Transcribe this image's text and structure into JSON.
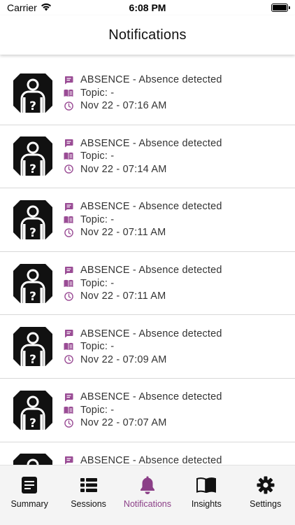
{
  "status": {
    "carrier": "Carrier",
    "time": "6:08 PM"
  },
  "header": {
    "title": "Notifications"
  },
  "colors": {
    "accent": "#8b3f87",
    "icon_purple": "#9a4c95"
  },
  "notifications": [
    {
      "type": "ABSENCE - Absence detected",
      "topic": "Topic: -",
      "time": "Nov 22 - 07:16 AM"
    },
    {
      "type": "ABSENCE - Absence detected",
      "topic": "Topic: -",
      "time": "Nov 22 - 07:14 AM"
    },
    {
      "type": "ABSENCE - Absence detected",
      "topic": "Topic: -",
      "time": "Nov 22 - 07:11 AM"
    },
    {
      "type": "ABSENCE - Absence detected",
      "topic": "Topic: -",
      "time": "Nov 22 - 07:11 AM"
    },
    {
      "type": "ABSENCE - Absence detected",
      "topic": "Topic: -",
      "time": "Nov 22 - 07:09 AM"
    },
    {
      "type": "ABSENCE - Absence detected",
      "topic": "Topic: -",
      "time": "Nov 22 - 07:07 AM"
    },
    {
      "type": "ABSENCE - Absence detected",
      "topic": "",
      "time": ""
    }
  ],
  "tabs": [
    {
      "label": "Summary",
      "icon": "summary-icon"
    },
    {
      "label": "Sessions",
      "icon": "list-icon"
    },
    {
      "label": "Notifications",
      "icon": "bell-icon",
      "active": true
    },
    {
      "label": "Insights",
      "icon": "book-icon"
    },
    {
      "label": "Settings",
      "icon": "gear-icon"
    }
  ]
}
